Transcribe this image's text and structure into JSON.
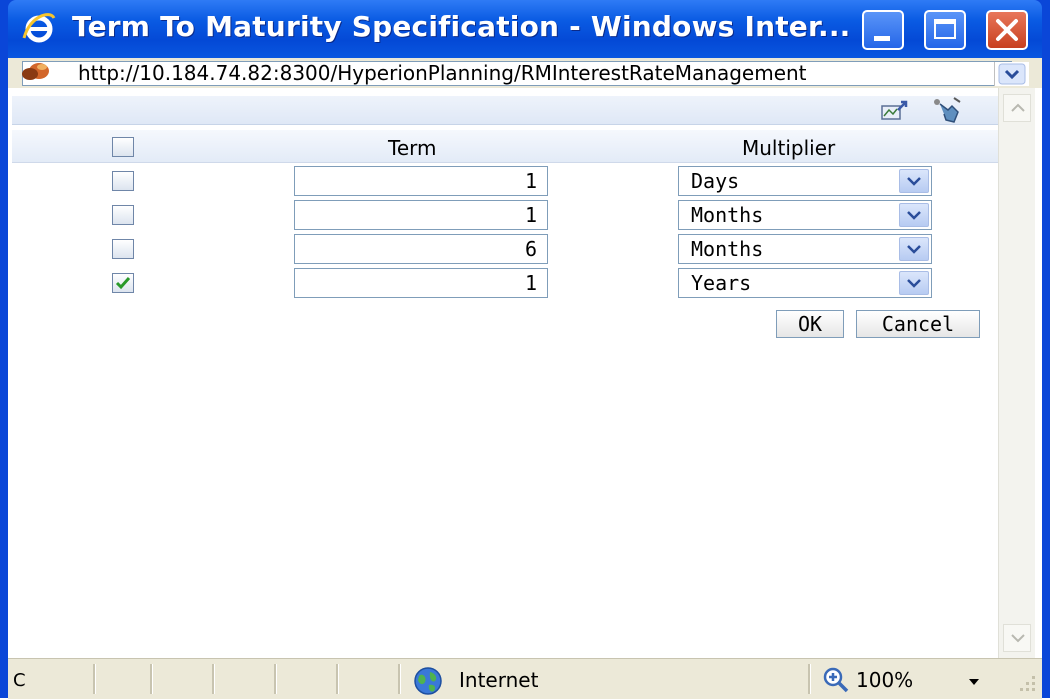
{
  "window": {
    "title": "Term To Maturity Specification - Windows Inter...",
    "url": "http://10.184.74.82:8300/HyperionPlanning/RMInterestRateManagement"
  },
  "table": {
    "headers": {
      "term": "Term",
      "multiplier": "Multiplier"
    },
    "rows": [
      {
        "checked": false,
        "term": "1",
        "multiplier": "Days"
      },
      {
        "checked": false,
        "term": "1",
        "multiplier": "Months"
      },
      {
        "checked": false,
        "term": "6",
        "multiplier": "Months"
      },
      {
        "checked": true,
        "term": "1",
        "multiplier": "Years"
      }
    ]
  },
  "buttons": {
    "ok": "OK",
    "cancel": "Cancel"
  },
  "statusbar": {
    "left_glyph": "Ⅽ",
    "zone": "Internet",
    "zoom": "100%"
  },
  "colors": {
    "titlebar": "#0a5be3",
    "check": "#2a9a2a",
    "close_button": "#c8401f"
  },
  "icons": [
    "ie-logo-icon",
    "minimize-icon",
    "maximize-icon",
    "close-icon",
    "page-icon",
    "export-icon",
    "help-icon",
    "dropdown-arrow-icon",
    "globe-icon",
    "zoom-icon"
  ]
}
